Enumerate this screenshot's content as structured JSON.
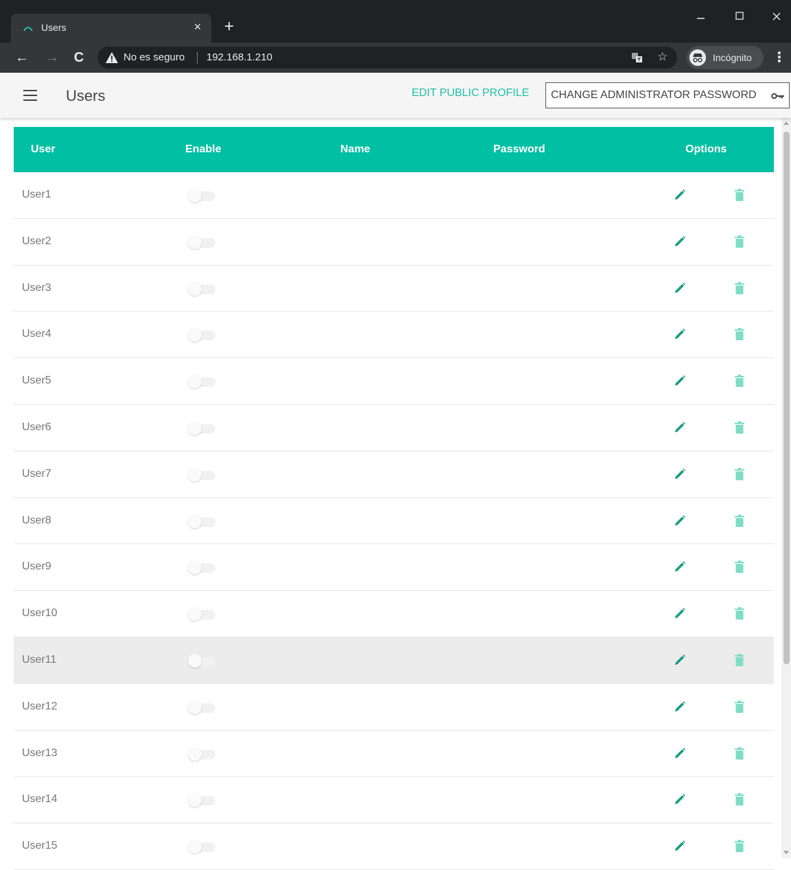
{
  "browser": {
    "tab_title": "Users",
    "tab_close": "×",
    "new_tab": "+",
    "warning": "No es seguro",
    "url": "192.168.1.210",
    "incognito_label": "Incógnito",
    "window_controls": [
      "minimize-icon",
      "maximize-icon",
      "close-icon"
    ]
  },
  "appbar": {
    "title": "Users",
    "edit_profile": "EDIT PUBLIC PROFILE",
    "change_password": "CHANGE ADMINISTRATOR PASSWORD"
  },
  "table": {
    "headers": {
      "user": "User",
      "enable": "Enable",
      "name": "Name",
      "password": "Password",
      "options": "Options"
    },
    "rows": [
      {
        "user": "User1",
        "enabled": false
      },
      {
        "user": "User2",
        "enabled": false
      },
      {
        "user": "User3",
        "enabled": false
      },
      {
        "user": "User4",
        "enabled": false
      },
      {
        "user": "User5",
        "enabled": false
      },
      {
        "user": "User6",
        "enabled": false
      },
      {
        "user": "User7",
        "enabled": false
      },
      {
        "user": "User8",
        "enabled": false
      },
      {
        "user": "User9",
        "enabled": false
      },
      {
        "user": "User10",
        "enabled": false
      },
      {
        "user": "User11",
        "enabled": false,
        "hovered": true
      },
      {
        "user": "User12",
        "enabled": false
      },
      {
        "user": "User13",
        "enabled": false
      },
      {
        "user": "User14",
        "enabled": false
      },
      {
        "user": "User15",
        "enabled": false
      }
    ],
    "row_icons": [
      "pencil-icon",
      "trash-icon"
    ]
  },
  "colors": {
    "accent": "#00bfa2",
    "edit_icon": "#1a9c82",
    "delete_icon": "#7fdcc7",
    "browser_dark": "#202124",
    "browser_toolbar": "#35363a"
  }
}
